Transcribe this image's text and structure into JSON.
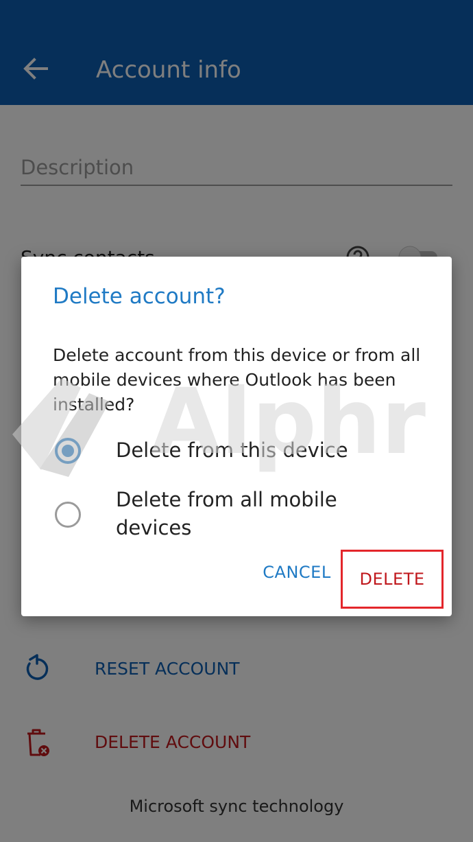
{
  "appbar": {
    "title": "Account info",
    "back_icon": "arrow-left-icon",
    "color": "#0d5fb3"
  },
  "settings": {
    "description_placeholder": "Description",
    "sync_contacts_label": "Sync contacts",
    "reset_account_label": "RESET ACCOUNT",
    "reset_icon": "refresh-icon",
    "delete_account_label": "DELETE ACCOUNT",
    "delete_icon": "trash-icon",
    "footer": "Microsoft sync technology"
  },
  "dialog": {
    "title": "Delete account?",
    "body": "Delete account from this device or from all mobile devices where Outlook has been installed?",
    "options": [
      {
        "label": "Delete from this device",
        "selected": true
      },
      {
        "label": "Delete from all mobile devices",
        "selected": false
      }
    ],
    "cancel_label": "CANCEL",
    "delete_label": "DELETE",
    "accent_color": "#1f7ac4",
    "danger_color": "#c0181d"
  },
  "watermark": {
    "text": "Alphr"
  }
}
